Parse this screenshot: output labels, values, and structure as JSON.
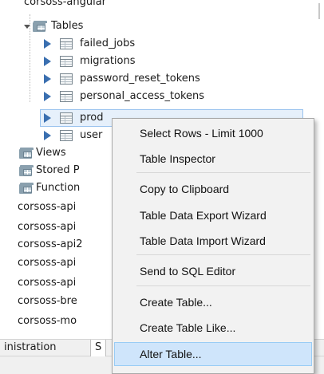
{
  "navigator": {
    "top_schema": "corsoss-angular",
    "tables_folder": "Tables",
    "tables": [
      "failed_jobs",
      "migrations",
      "password_reset_tokens",
      "personal_access_tokens",
      "prod",
      "user"
    ],
    "views_folder": "Views",
    "stored_procedures_folder": "Stored P",
    "functions_folder": "Function",
    "schemas": [
      "corsoss-api",
      "corsoss-api",
      "corsoss-api2",
      "corsoss-api",
      "corsoss-api",
      "corsoss-bre",
      "corsoss-mo"
    ]
  },
  "bottom_tabs": {
    "administration": "inistration",
    "schemas": "S"
  },
  "context_menu": {
    "items": [
      "Select Rows - Limit 1000",
      "Table Inspector",
      "Copy to Clipboard",
      "Table Data Export Wizard",
      "Table Data Import Wizard",
      "Send to SQL Editor",
      "Create Table...",
      "Create Table Like...",
      "Alter Table..."
    ],
    "hovered_item": "Alter Table..."
  },
  "colors": {
    "menu_bg": "#f2f2f2",
    "menu_hover": "#cfe5fb",
    "row_selected": "#e6f0fb",
    "arrow_blue": "#3a6fb0"
  },
  "icons": {
    "expand_arrow": "chevron-down-icon",
    "collapse_arrow": "triangle-right-icon",
    "table": "table-icon",
    "folder": "folder-icon"
  }
}
